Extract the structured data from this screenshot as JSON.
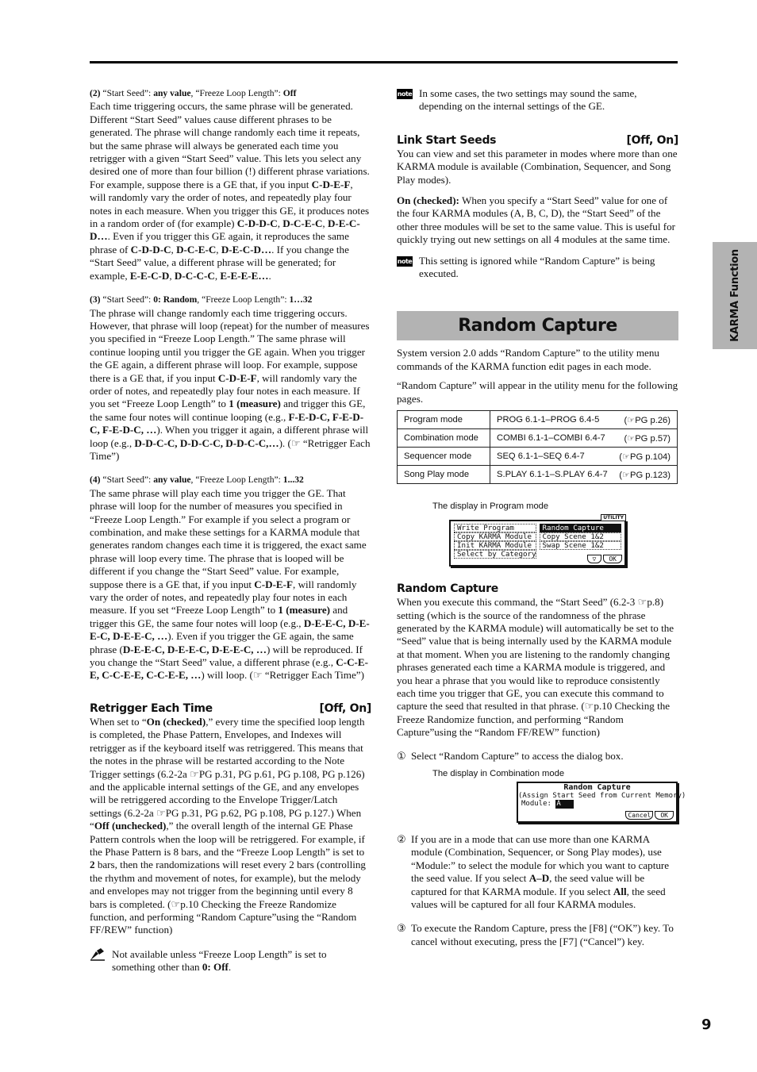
{
  "page": {
    "number": "9",
    "side_tab": "KARMA Function"
  },
  "left": {
    "case2": {
      "head_num": "(2)",
      "head_a": " “Start Seed”: ",
      "head_a_val": "any value",
      "head_b": ", “Freeze Loop Length”: ",
      "head_b_val": "Off",
      "text_1": "Each time triggering occurs, the same phrase will be generated. Different “Start Seed” values cause different phrases to be generated. The phrase will change randomly each time it repeats, but the same phrase will always be generated each time you retrigger with a given “Start Seed” value. This lets you select any desired one of more than four billion (!) different phrase variations. For example, suppose there is a GE that, if you input ",
      "bold_1": "C-D-E-F",
      "text_2": ", will randomly vary the order of notes, and repeatedly play four notes in each measure. When you trigger this GE, it produces notes in a random order of (for example) ",
      "bold_2": "C-D-D-C",
      "sep_a": ", ",
      "bold_3": "D-C-E-C",
      "sep_b": ", ",
      "bold_4": "D-E-C-D…",
      "text_3": ". Even if you trigger this GE again, it reproduces the same phrase of ",
      "bold_5": "C-D-D-C",
      "sep_c": ", ",
      "bold_6": "D-C-E-C",
      "sep_d": ", ",
      "bold_7": "D-E-C-D…",
      "text_4": ". If you change the “Start Seed” value, a different phrase will be generated; for example, ",
      "bold_8": "E-E-C-D",
      "sep_e": ", ",
      "bold_9": "D-C-C-C",
      "sep_f": ", ",
      "bold_10": "E-E-E-E…",
      "text_5": "."
    },
    "case3": {
      "head_num": "(3)",
      "head_a": " “Start Seed”: ",
      "head_a_val": "0: Random",
      "head_b": ", “Freeze Loop Length”: ",
      "head_b_val": "1…32",
      "text_1": "The phrase will change randomly each time triggering occurs. However, that phrase will loop (repeat) for the number of measures you specified in “Freeze Loop Length.” The same phrase will continue looping until you trigger the GE again. When you trigger the GE again, a different phrase will loop. For example, suppose there is a GE that, if you input ",
      "bold_1": "C-D-E-F",
      "text_2": ", will randomly vary the order of notes, and repeatedly play four notes in each measure. If you set “Freeze Loop Length” to ",
      "bold_2": "1 (measure)",
      "text_3": " and trigger this GE, the same four notes will continue looping (e.g., ",
      "bold_3": "F-E-D-C, F-E-D-C, F-E-D-C, …",
      "text_4": "). When you trigger it again, a different phrase will loop (e.g., ",
      "bold_4": "D-D-C-C, D-D-C-C, D-D-C-C,…",
      "text_5": "). (☞ “Retrigger Each Time”)"
    },
    "case4": {
      "head_num": "(4)",
      "head_a": " “Start Seed”: ",
      "head_a_val": "any value",
      "head_b": ", “Freeze Loop Length”: ",
      "head_b_val": "1...32",
      "text_1": "The same phrase will play each time you trigger the GE. That phrase will loop for the number of measures you specified in “Freeze Loop Length.” For example if you select a program or combination, and make these settings for a KARMA module that generates random changes each time it is triggered, the exact same phrase will loop every time. The phrase that is looped will be different if you change the “Start Seed” value. For example, suppose there is a GE that, if you input ",
      "bold_1": "C-D-E-F",
      "text_2": ", will randomly vary the order of notes, and repeatedly play four notes in each measure. If you set “Freeze Loop Length” to ",
      "bold_2": "1 (measure)",
      "text_3": " and trigger this GE, the same four notes will loop (e.g., ",
      "bold_3": "D-E-E-C, D-E-E-C, D-E-E-C, …",
      "text_4": "). Even if you trigger the GE again, the same phrase (",
      "bold_4": "D-E-E-C, D-E-E-C, D-E-E-C, …",
      "text_5": ") will be reproduced. If you change the “Start Seed” value, a different phrase (e.g., ",
      "bold_5": "C-C-E-E, C-C-E-E, C-C-E-E, …",
      "text_6": ") will loop. (☞ “Retrigger Each Time”)"
    },
    "retrigger": {
      "title": "Retrigger Each Time",
      "range": "[Off, On]",
      "text_1": "When set to “",
      "bold_1": "On (checked)",
      "text_2": ",” every time the specified loop length is completed, the Phase Pattern, Envelopes, and Indexes will retrigger as if the keyboard itself was retriggered. This means that the notes in the phrase will be restarted according to the Note Trigger settings (6.2-2a ☞PG p.31, PG p.61, PG p.108, PG p.126) and the applicable internal settings of the GE, and any envelopes will be retriggered according to the Envelope Trigger/Latch settings (6.2-2a ☞PG p.31, PG p.62, PG p.108, PG p.127.) When “",
      "bold_2": "Off (unchecked)",
      "text_3": ",” the overall length of the internal GE Phase Pattern controls when the loop will be retriggered. For example, if the Phase Pattern is 8 bars, and the “Freeze Loop Length” is set to ",
      "bold_3": "2",
      "text_4": " bars, then the randomizations will reset every 2 bars (controlling the rhythm and movement of notes, for example), but the melody and envelopes may not trigger from the beginning until every 8 bars is completed. (☞p.10 Checking the Freeze Randomize function, and performing “Random Capture”using the “Random FF/REW” function)",
      "warning_text": "Not available unless “Freeze Loop Length” is set to something other than ",
      "warning_bold": "0: Off",
      "warning_end": "."
    }
  },
  "right": {
    "note_1": "In some cases, the two settings may sound the same, depending on the internal settings of the GE.",
    "note_label": "note",
    "link": {
      "title": "Link Start Seeds",
      "range": "[Off, On]",
      "text": "You can view and set this parameter in modes where more than one KARMA module is available (Combination, Sequencer, and Song Play modes).",
      "on_label": "On (checked):",
      "on_text": " When you specify a “Start Seed” value for one of the four KARMA modules (A, B, C, D), the “Start Seed” of the other three modules will be set to the same value. This is useful for quickly trying out new settings on all 4 modules at the same time.",
      "note": "This setting is ignored while “Random Capture” is being executed."
    },
    "banner": "Random Capture",
    "intro_1": "System version 2.0 adds “Random Capture” to the utility menu commands of the KARMA function edit pages in each mode.",
    "intro_2": "“Random Capture” will appear in the utility menu for the following pages.",
    "modes_table": [
      {
        "mode": "Program mode",
        "pages": "PROG 6.1-1–PROG 6.4-5",
        "ref": "(☞PG p.26)"
      },
      {
        "mode": "Combination mode",
        "pages": "COMBI 6.1-1–COMBI 6.4-7",
        "ref": "(☞PG p.57)"
      },
      {
        "mode": "Sequencer mode",
        "pages": "SEQ 6.1-1–SEQ 6.4-7",
        "ref": "(☞PG p.104)"
      },
      {
        "mode": "Song Play mode",
        "pages": "S.PLAY 6.1-1–S.PLAY 6.4-7",
        "ref": "(☞PG p.123)"
      }
    ],
    "program_display": {
      "caption": "The display in Program mode",
      "tag": "UTILITY",
      "items": [
        "Write Program",
        "Random Capture",
        "Copy KARMA Module",
        "Copy Scene 1&2",
        "Init KARMA Module",
        "Swap Scene 1&2",
        "Select by Category"
      ],
      "selected": "Random Capture",
      "down_button": "▽",
      "ok_button": "OK"
    },
    "rc_section": {
      "title": "Random Capture",
      "text": "When you execute this command, the “Start Seed” (6.2-3 ☞p.8) setting (which is the source of the randomness of the phrase generated by the KARMA module) will automatically be set to the “Seed” value that is being internally used by the KARMA module at that moment. When you are listening to the randomly changing phrases generated each time a KARMA module is triggered, and you hear a phrase that you would like to reproduce consistently each time you trigger that GE, you can execute this command to capture the seed that resulted in that phrase. (☞p.10 Checking the Freeze Randomize function, and performing “Random Capture”using the “Random FF/REW” function)",
      "step1_num": "①",
      "step1": "Select “Random Capture” to access the dialog box."
    },
    "combi_display": {
      "caption": "The display in Combination mode",
      "title": "Random Capture",
      "subtitle": "(Assign Start Seed from Current Memory)",
      "module_label": "Module:",
      "module_value": "A",
      "cancel_button": "Cancel",
      "ok_button": "OK"
    },
    "step2": {
      "num": "②",
      "text_1": "If you are in a mode that can use more than one KARMA module (Combination, Sequencer, or Song Play modes), use “Module:” to select the module for which you want to capture the seed value. If you select ",
      "bold_1": "A–D",
      "text_2": ", the seed value will be captured for that KARMA module. If you select ",
      "bold_2": "All",
      "text_3": ", the seed values will be captured for all four KARMA modules."
    },
    "step3": {
      "num": "③",
      "text": "To execute the Random Capture, press the [F8] (“OK”) key. To cancel without executing, press the [F7] (“Cancel”) key."
    }
  }
}
